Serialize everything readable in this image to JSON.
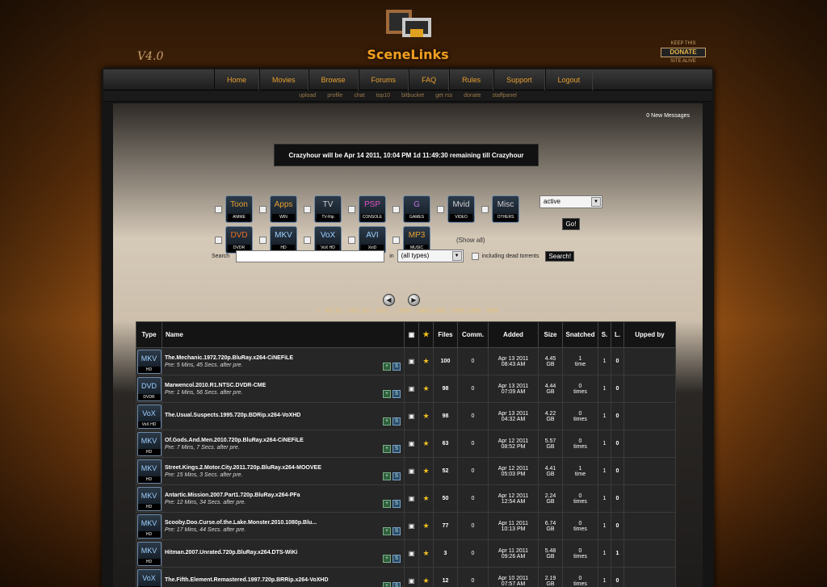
{
  "brand": {
    "title": "SceneLinks",
    "version": "V4.0"
  },
  "donate": {
    "top": "KEEP THIS",
    "button": "DONATE",
    "bottom": "SITE ALIVE"
  },
  "nav": [
    "Home",
    "Movies",
    "Browse",
    "Forums",
    "FAQ",
    "Rules",
    "Support",
    "Logout"
  ],
  "subnav": [
    "upload",
    "profile",
    "chat",
    "top10",
    "bitbucket",
    "get rss",
    "donate",
    "staffpanel"
  ],
  "messages": "0 New Messages",
  "banner": "Crazyhour will be Apr 14 2011, 10:04 PM 1d 11:49:30 remaining till Crazyhour",
  "categories_row1": [
    {
      "main": "Toon",
      "sub": "ANIME",
      "color": "#e8a030"
    },
    {
      "main": "Apps",
      "sub": "WIN",
      "color": "#e8a030"
    },
    {
      "main": "TV",
      "sub": "TV-Rip",
      "color": "#cfcfcf"
    },
    {
      "main": "PSP",
      "sub": "CONSOLE",
      "color": "#e050c0"
    },
    {
      "main": "G",
      "sub": "GAMES",
      "color": "#c070e0"
    },
    {
      "main": "Mvid",
      "sub": "VIDEO",
      "color": "#cfcfcf"
    },
    {
      "main": "Misc",
      "sub": "OTHERS",
      "color": "#cfcfcf"
    }
  ],
  "categories_row2": [
    {
      "main": "DVD",
      "sub": "DVDR",
      "color": "#e87020"
    },
    {
      "main": "MKV",
      "sub": "HD",
      "color": "#9fd1ff"
    },
    {
      "main": "VoX",
      "sub": "VoX HD",
      "color": "#9fd1ff"
    },
    {
      "main": "AVI",
      "sub": "XviD",
      "color": "#9fd1ff"
    },
    {
      "main": "MP3",
      "sub": "MUSIC",
      "color": "#e8a030"
    }
  ],
  "show_all": "(Show all)",
  "filter": {
    "value": "active",
    "go": "Go!"
  },
  "search": {
    "label": "Search",
    "in": "in",
    "type_value": "(all types)",
    "dead_label": "including dead torrents",
    "button": "Search!"
  },
  "pager": "1 - 50 | 51 - 100 | 101 - 150 | ... | 2851 - 2900 | 2901 - 2950 | 2951 - 2993",
  "table": {
    "headers": [
      "Type",
      "Name",
      "Files",
      "Comm.",
      "Added",
      "Size",
      "Snatched",
      "S.",
      "L.",
      "Upped by"
    ],
    "rows": [
      {
        "type_main": "MKV",
        "type_sub": "HD",
        "name": "The.Mechanic.1972.720p.BluRay.x264-CiNEFiLE",
        "pre": "Pre: 5 Mins, 45 Secs. after pre.",
        "files": "100",
        "comments": "0",
        "added_date": "Apr 13 2011",
        "added_time": "08:43 AM",
        "size_num": "4.45",
        "size_unit": "GB",
        "snatched_num": "1",
        "snatched_unit": "time",
        "seeders": "1",
        "leechers": "0",
        "upped_by": ""
      },
      {
        "type_main": "DVD",
        "type_sub": "DVDR",
        "name": "Marwencol.2010.R1.NTSC.DVDR-CME",
        "pre": "Pre: 1 Mins, 56 Secs. after pre.",
        "files": "98",
        "comments": "0",
        "added_date": "Apr 13 2011",
        "added_time": "07:09 AM",
        "size_num": "4.44",
        "size_unit": "GB",
        "snatched_num": "0",
        "snatched_unit": "times",
        "seeders": "1",
        "leechers": "0",
        "upped_by": ""
      },
      {
        "type_main": "VoX",
        "type_sub": "VoX HD",
        "name": "The.Usual.Suspects.1995.720p.BDRip.x264-VoXHD",
        "pre": "",
        "files": "98",
        "comments": "0",
        "added_date": "Apr 13 2011",
        "added_time": "04:32 AM",
        "size_num": "4.22",
        "size_unit": "GB",
        "snatched_num": "0",
        "snatched_unit": "times",
        "seeders": "1",
        "leechers": "0",
        "upped_by": ""
      },
      {
        "type_main": "MKV",
        "type_sub": "HD",
        "name": "Of.Gods.And.Men.2010.720p.BluRay.x264-CiNEFiLE",
        "pre": "Pre: 7 Mins, 7 Secs. after pre.",
        "files": "63",
        "comments": "0",
        "added_date": "Apr 12 2011",
        "added_time": "08:52 PM",
        "size_num": "5.57",
        "size_unit": "GB",
        "snatched_num": "0",
        "snatched_unit": "times",
        "seeders": "1",
        "leechers": "0",
        "upped_by": ""
      },
      {
        "type_main": "MKV",
        "type_sub": "HD",
        "name": "Street.Kings.2.Motor.City.2011.720p.BluRay.x264-MOOVEE",
        "pre": "Pre: 15 Mins, 3 Secs. after pre.",
        "files": "52",
        "comments": "0",
        "added_date": "Apr 12 2011",
        "added_time": "05:03 PM",
        "size_num": "4.41",
        "size_unit": "GB",
        "snatched_num": "1",
        "snatched_unit": "time",
        "seeders": "1",
        "leechers": "0",
        "upped_by": ""
      },
      {
        "type_main": "MKV",
        "type_sub": "HD",
        "name": "Antartic.Mission.2007.Part1.720p.BluRay.x264-PFa",
        "pre": "Pre: 12 Mins, 34 Secs. after pre.",
        "files": "50",
        "comments": "0",
        "added_date": "Apr 12 2011",
        "added_time": "12:54 AM",
        "size_num": "2.24",
        "size_unit": "GB",
        "snatched_num": "0",
        "snatched_unit": "times",
        "seeders": "1",
        "leechers": "0",
        "upped_by": ""
      },
      {
        "type_main": "MKV",
        "type_sub": "HD",
        "name": "Scooby.Doo.Curse.of.the.Lake.Monster.2010.1080p.Blu...",
        "pre": "Pre: 17 Mins, 44 Secs. after pre.",
        "files": "77",
        "comments": "0",
        "added_date": "Apr 11 2011",
        "added_time": "10:13 PM",
        "size_num": "6.74",
        "size_unit": "GB",
        "snatched_num": "0",
        "snatched_unit": "times",
        "seeders": "1",
        "leechers": "0",
        "upped_by": ""
      },
      {
        "type_main": "MKV",
        "type_sub": "HD",
        "name": "Hitman.2007.Unrated.720p.BluRay.x264.DTS-WiKi",
        "pre": "",
        "files": "3",
        "comments": "0",
        "added_date": "Apr 11 2011",
        "added_time": "09:26 AM",
        "size_num": "5.48",
        "size_unit": "GB",
        "snatched_num": "0",
        "snatched_unit": "times",
        "seeders": "1",
        "leechers": "1",
        "upped_by": ""
      },
      {
        "type_main": "VoX",
        "type_sub": "VoX HD",
        "name": "The.Fifth.Element.Remastered.1997.720p.BRRip.x264-VoXHD",
        "pre": "",
        "files": "12",
        "comments": "0",
        "added_date": "Apr 10 2011",
        "added_time": "07:57 AM",
        "size_num": "2.19",
        "size_unit": "GB",
        "snatched_num": "0",
        "snatched_unit": "times",
        "seeders": "1",
        "leechers": "0",
        "upped_by": ""
      }
    ]
  },
  "colors": {
    "accent": "#e8a030",
    "bg": "#151515",
    "seed": "#2fbf3f"
  }
}
